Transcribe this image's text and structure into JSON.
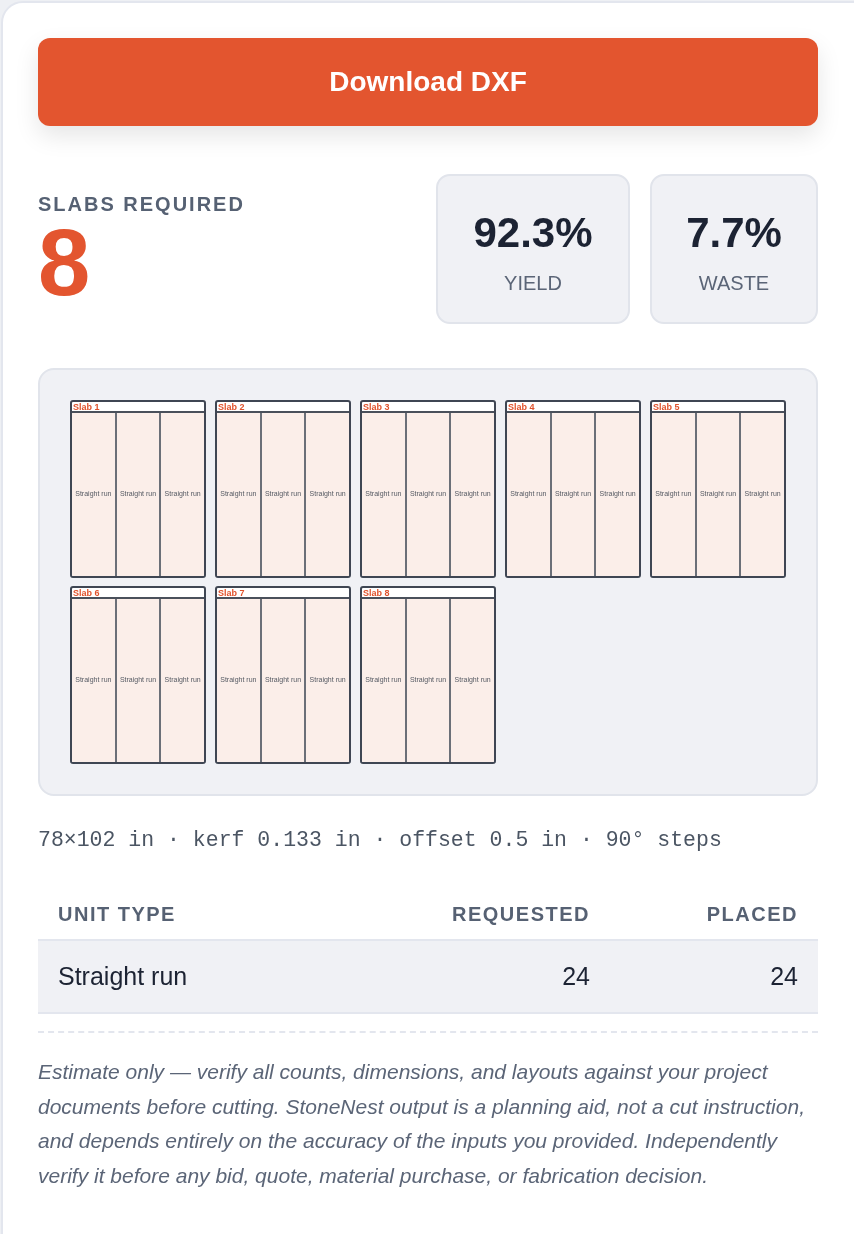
{
  "download_button": {
    "label": "Download DXF"
  },
  "summary": {
    "label": "SLABS REQUIRED",
    "value": "8"
  },
  "stats": [
    {
      "value": "92.3%",
      "label": "YIELD"
    },
    {
      "value": "7.7%",
      "label": "WASTE"
    }
  ],
  "layout": {
    "slabs": [
      {
        "label": "Slab 1",
        "pieces": [
          "Straight run",
          "Straight run",
          "Straight run"
        ]
      },
      {
        "label": "Slab 2",
        "pieces": [
          "Straight run",
          "Straight run",
          "Straight run"
        ]
      },
      {
        "label": "Slab 3",
        "pieces": [
          "Straight run",
          "Straight run",
          "Straight run"
        ]
      },
      {
        "label": "Slab 4",
        "pieces": [
          "Straight run",
          "Straight run",
          "Straight run"
        ]
      },
      {
        "label": "Slab 5",
        "pieces": [
          "Straight run",
          "Straight run",
          "Straight run"
        ]
      },
      {
        "label": "Slab 6",
        "pieces": [
          "Straight run",
          "Straight run",
          "Straight run"
        ]
      },
      {
        "label": "Slab 7",
        "pieces": [
          "Straight run",
          "Straight run",
          "Straight run"
        ]
      },
      {
        "label": "Slab 8",
        "pieces": [
          "Straight run",
          "Straight run",
          "Straight run"
        ]
      }
    ]
  },
  "spec_line": "78×102 in · kerf 0.133 in · offset 0.5 in · 90° steps",
  "table": {
    "columns": [
      "UNIT TYPE",
      "REQUESTED",
      "PLACED"
    ],
    "rows": [
      [
        "Straight run",
        "24",
        "24"
      ]
    ]
  },
  "disclaimer": "Estimate only — verify all counts, dimensions, and layouts against your project documents before cutting. StoneNest output is a planning aid, not a cut instruction, and depends entirely on the accuracy of the inputs you provided. Independently verify it before any bid, quote, material purchase, or fabrication decision."
}
